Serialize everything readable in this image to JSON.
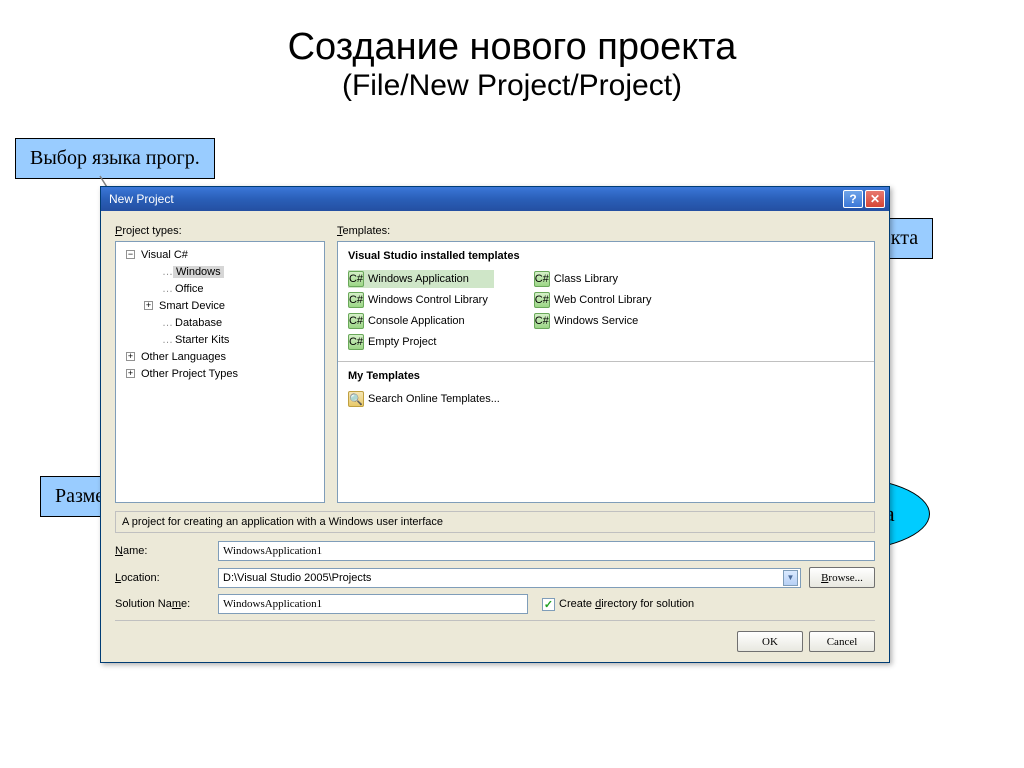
{
  "slide": {
    "title1": "Создание нового проекта",
    "title2": "(File/New Project/Project)"
  },
  "callouts": {
    "lang": "Выбор языка прогр.",
    "type": "Выбор типа проекта",
    "location": "Размещение проекта",
    "name": "Имя  проекта"
  },
  "dialog": {
    "title": "New Project",
    "project_types_label_pre": "P",
    "project_types_label": "roject types:",
    "templates_label_pre": "T",
    "templates_label": "emplates:",
    "tree": {
      "root": "Visual C#",
      "children": [
        "Windows",
        "Office",
        "Smart Device",
        "Database",
        "Starter Kits"
      ],
      "siblings": [
        "Other Languages",
        "Other Project Types"
      ]
    },
    "templates": {
      "header1": "Visual Studio installed templates",
      "col1": [
        "Windows Application",
        "Windows Control Library",
        "Console Application",
        "Empty Project"
      ],
      "col2": [
        "Class Library",
        "Web Control Library",
        "Windows Service"
      ],
      "header2": "My Templates",
      "search": "Search Online Templates..."
    },
    "description": "A project for creating an application with a Windows user interface",
    "name_label_pre": "N",
    "name_label": "ame:",
    "name_value": "WindowsApplication1",
    "location_label_pre": "L",
    "location_label": "ocation:",
    "location_value": "D:\\Visual Studio 2005\\Projects",
    "browse_pre": "B",
    "browse": "rowse...",
    "solution_label": "Solution Na",
    "solution_label_u": "m",
    "solution_label_post": "e:",
    "solution_value": "WindowsApplication1",
    "create_dir_pre": "Create ",
    "create_dir_u": "d",
    "create_dir_post": "irectory for solution",
    "ok": "OK",
    "cancel": "Cancel"
  }
}
